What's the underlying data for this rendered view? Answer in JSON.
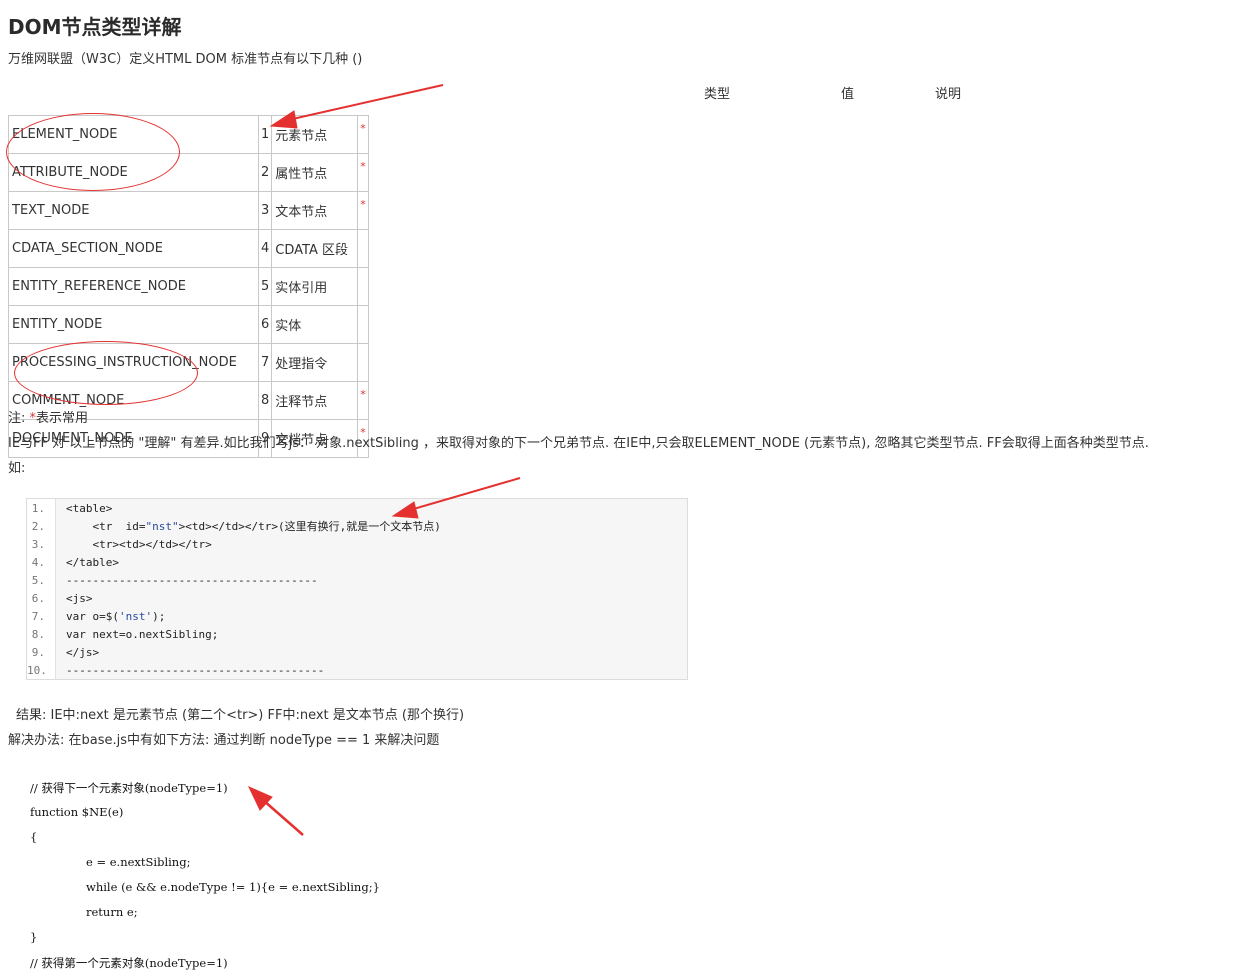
{
  "title": "DOM节点类型详解",
  "intro": "万维网联盟（W3C）定义HTML DOM 标准节点有以下几种 ()",
  "table_headers": [
    "类型",
    "值",
    "说明"
  ],
  "node_rows": [
    {
      "name": "ELEMENT_NODE",
      "value": "1",
      "desc": "元素节点",
      "mark": "*"
    },
    {
      "name": "ATTRIBUTE_NODE",
      "value": "2",
      "desc": "属性节点",
      "mark": "*"
    },
    {
      "name": "TEXT_NODE",
      "value": "3",
      "desc": "文本节点",
      "mark": "*"
    },
    {
      "name": "CDATA_SECTION_NODE",
      "value": "4",
      "desc": "CDATA 区段",
      "mark": ""
    },
    {
      "name": "ENTITY_REFERENCE_NODE",
      "value": "5",
      "desc": "实体引用",
      "mark": ""
    },
    {
      "name": "ENTITY_NODE",
      "value": "6",
      "desc": "实体",
      "mark": ""
    },
    {
      "name": "PROCESSING_INSTRUCTION_NODE",
      "value": "7",
      "desc": "处理指令",
      "mark": ""
    },
    {
      "name": "COMMENT_NODE",
      "value": "8",
      "desc": "注释节点",
      "mark": "*"
    },
    {
      "name": "DOCUMENT_NODE",
      "value": "9",
      "desc": "文档节点",
      "mark": "*"
    }
  ],
  "note": {
    "prefix": "注:",
    "star": "*",
    "text": "表示常用"
  },
  "paragraph1": "IE与FF 对 以上节点的 \"理解\" 有差异.如比我们写js： 对象.nextSibling   ，来取得对象的下一个兄弟节点. 在IE中,只会取ELEMENT_NODE (元素节点), 忽略其它类型节点.     FF会取得上面各种类型节点.",
  "paragraph1_cont": "如:",
  "code_block": [
    {
      "n": "1.",
      "text": "<table>"
    },
    {
      "n": "2.",
      "pre": "    <tr  id=",
      "str": "\"nst\"",
      "post": "><td></td></tr>(这里有换行,就是一个文本节点)"
    },
    {
      "n": "3.",
      "text": "    <tr><td></td></tr>"
    },
    {
      "n": "4.",
      "text": "</table>"
    },
    {
      "n": "5.",
      "text": "--------------------------------------"
    },
    {
      "n": "6.",
      "text": "<js>"
    },
    {
      "n": "7.",
      "pre": "var o=$(",
      "str": "'nst'",
      "post": ");"
    },
    {
      "n": "8.",
      "text": "var next=o.nextSibling;"
    },
    {
      "n": "9.",
      "text": "</js>"
    },
    {
      "n": "10.",
      "text": "---------------------------------------"
    }
  ],
  "result": "结果: IE中:next 是元素节点 (第二个<tr>) FF中:next 是文本节点 (那个换行)",
  "solution": "解决办法: 在base.js中有如下方法:  通过判断 nodeType == 1  来解决问题",
  "code2": {
    "comment1": "// 获得下一个元素对象(nodeType=1)",
    "fn": "function $NE(e)",
    "open": "{",
    "l1": "e = e.nextSibling;",
    "l2": "while (e && e.nodeType != 1){e = e.nextSibling;}",
    "l3": "return e;",
    "close": "}",
    "comment2": "// 获得第一个元素对象(nodeType=1)"
  }
}
